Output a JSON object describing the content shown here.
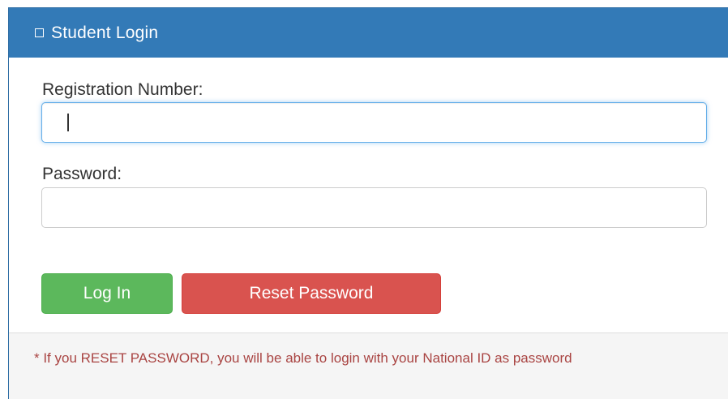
{
  "panel": {
    "title": "Student Login",
    "title_icon": "square-outline-icon",
    "heading_color": "#337ab7"
  },
  "form": {
    "registration": {
      "label": "Registration Number:",
      "value": "",
      "placeholder": ""
    },
    "password": {
      "label": "Password:",
      "value": "",
      "placeholder": ""
    }
  },
  "buttons": {
    "login_label": "Log In",
    "login_color": "#5cb85c",
    "reset_label": "Reset Password",
    "reset_color": "#d9534f"
  },
  "footer": {
    "note": "* If you RESET PASSWORD, you will be able to login with your National ID as password"
  }
}
